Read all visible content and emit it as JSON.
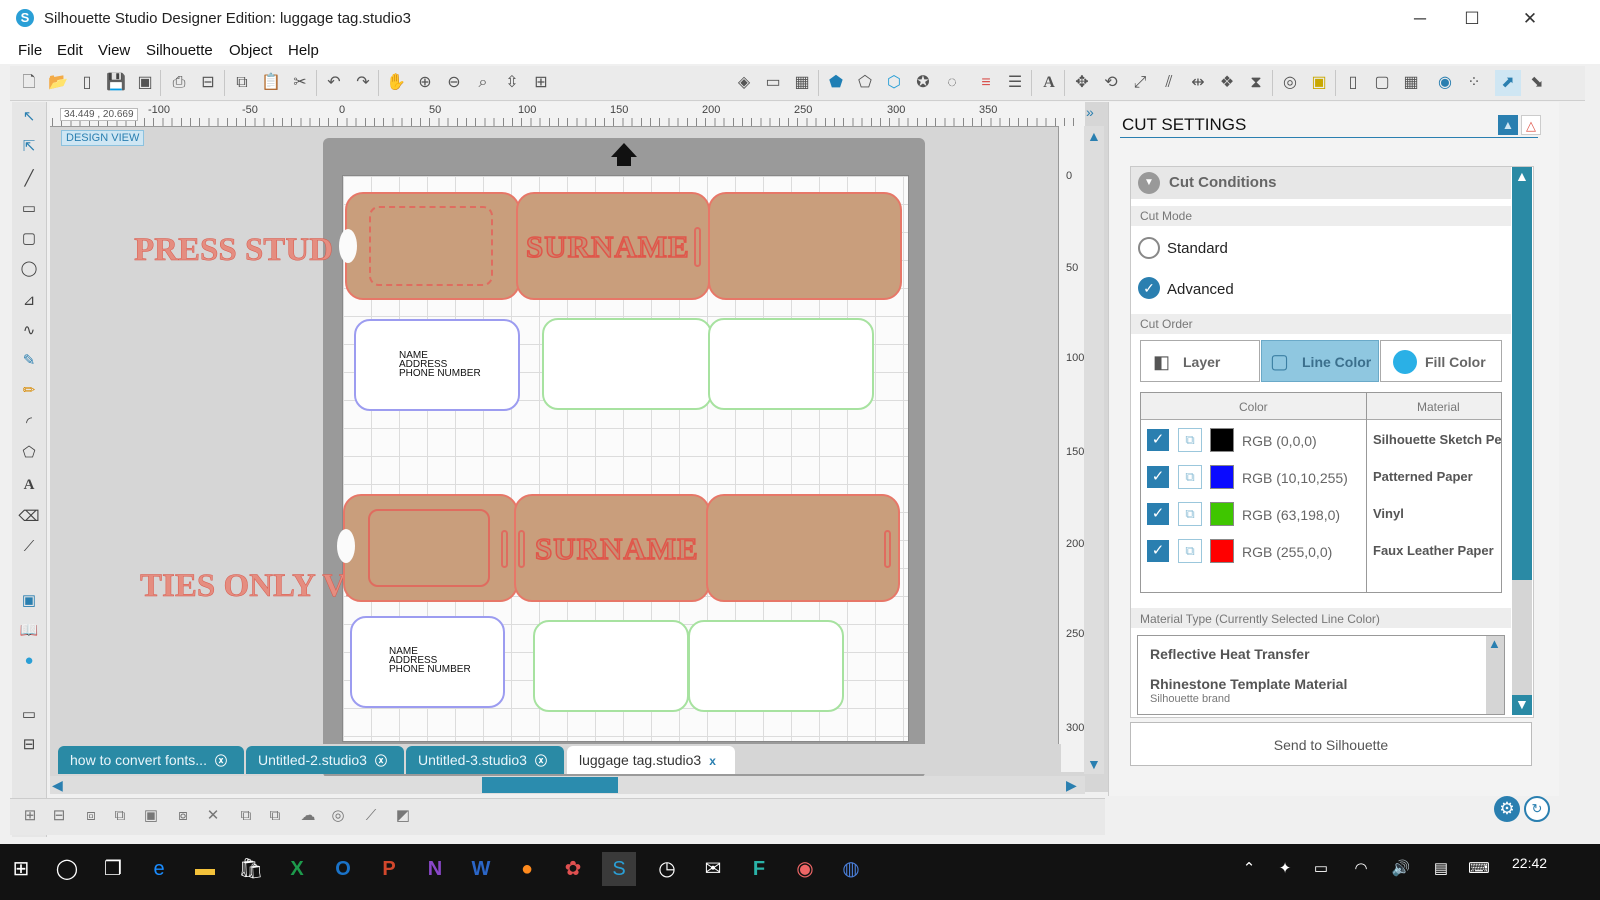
{
  "window": {
    "title": "Silhouette Studio Designer Edition: luggage tag.studio3",
    "minimize": "─",
    "maximize": "☐",
    "close": "✕"
  },
  "menu": [
    "File",
    "Edit",
    "View",
    "Silhouette",
    "Object",
    "Help"
  ],
  "canvas": {
    "coords": "34.449 , 20.669",
    "design_view": "DESIGN VIEW",
    "h_ticks": [
      "-100",
      "-50",
      "0",
      "50",
      "100",
      "150",
      "200",
      "250",
      "300",
      "350"
    ],
    "v_ticks": [
      "0",
      "50",
      "100",
      "150",
      "200",
      "250",
      "300"
    ],
    "press_stud_label": "PRESS STUD VERSION",
    "ties_only_label": "TIES ONLY VERSION",
    "surname_1": "SURNAME",
    "surname_2": "SURNAME",
    "tag_text_1": [
      "NAME",
      "ADDRESS",
      "PHONE NUMBER"
    ],
    "tag_text_2": [
      "NAME",
      "ADDRESS",
      "PHONE NUMBER"
    ]
  },
  "doc_tabs": [
    {
      "label": "how to convert fonts...",
      "active": false
    },
    {
      "label": "Untitled-2.studio3",
      "active": false
    },
    {
      "label": "Untitled-3.studio3",
      "active": false
    },
    {
      "label": "luggage tag.studio3",
      "active": true
    }
  ],
  "panel": {
    "title": "CUT SETTINGS",
    "section": "Cut Conditions",
    "cut_mode_label": "Cut Mode",
    "modes": [
      {
        "label": "Standard",
        "selected": false
      },
      {
        "label": "Advanced",
        "selected": true
      }
    ],
    "cut_order_label": "Cut Order",
    "cut_order": [
      {
        "label": "Layer",
        "selected": false
      },
      {
        "label": "Line Color",
        "selected": true
      },
      {
        "label": "Fill Color",
        "selected": false
      }
    ],
    "table_headers": {
      "color": "Color",
      "material": "Material"
    },
    "rows": [
      {
        "checked": true,
        "swatch": "#000000",
        "label": "RGB (0,0,0)",
        "material": "Silhouette Sketch Pe"
      },
      {
        "checked": true,
        "swatch": "#0a0aff",
        "label": "RGB (10,10,255)",
        "material": "Patterned Paper"
      },
      {
        "checked": true,
        "swatch": "#3fc600",
        "label": "RGB (63,198,0)",
        "material": "Vinyl"
      },
      {
        "checked": true,
        "swatch": "#ff0000",
        "label": "RGB (255,0,0)",
        "material": "Faux Leather Paper"
      }
    ],
    "material_type_label": "Material Type (Currently Selected Line Color)",
    "materials": [
      {
        "name": "Reflective Heat Transfer",
        "sub": ""
      },
      {
        "name": "Rhinestone Template Material",
        "sub": "Silhouette brand"
      }
    ],
    "send_button": "Send to Silhouette"
  },
  "taskbar": {
    "time": "22:42"
  },
  "colors": {
    "accent": "#2a7fb0",
    "tag_fill": "#c99e7c",
    "tag_outline": "#e77768",
    "tab_bg": "#2a8aa5"
  }
}
